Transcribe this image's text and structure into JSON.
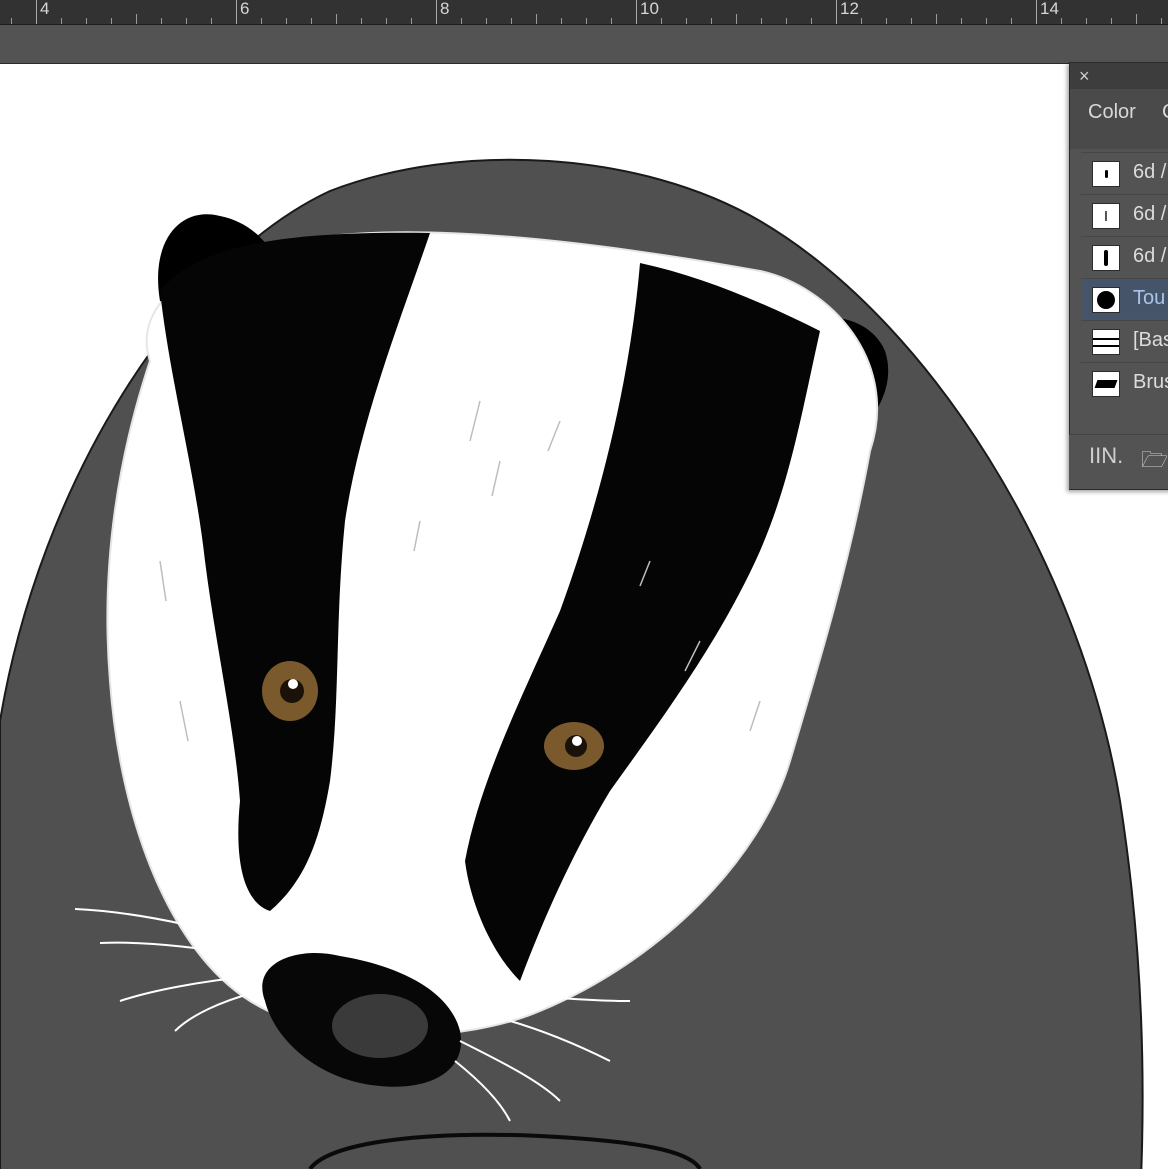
{
  "ruler": {
    "labels": [
      "4",
      "6",
      "8",
      "10",
      "12",
      "14"
    ]
  },
  "panel": {
    "close_label": "×",
    "tabs": [
      "Color",
      "C"
    ],
    "brushes": [
      {
        "name": "6d /",
        "icon": "dot-small-icon"
      },
      {
        "name": "6d /",
        "icon": "dot-thin-icon"
      },
      {
        "name": "6d /",
        "icon": "oval-icon"
      },
      {
        "name": "Tou",
        "icon": "circle-fill-icon",
        "selected": true
      },
      {
        "name": "[Bas",
        "icon": "line-basic-icon"
      },
      {
        "name": "Brus",
        "icon": "brush-stroke-icon"
      }
    ],
    "footer": {
      "library_icon": "IIN.",
      "new_icon": "folder-icon"
    }
  },
  "colors": {
    "ruler_bg": "#323232",
    "pasteboard": "#535353",
    "circle": "#505050",
    "panel_bg": "#535353",
    "selected_row": "#46546a",
    "eye": "#7a5a2c"
  }
}
